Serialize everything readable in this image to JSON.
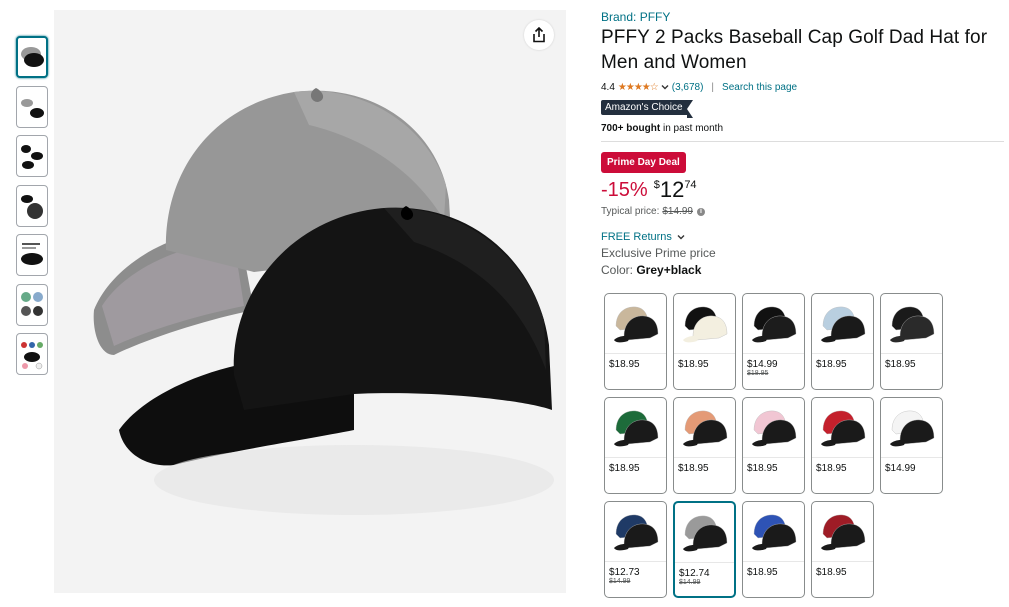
{
  "thumbnails": [
    {
      "name": "Grey+black main"
    },
    {
      "name": "Grey+black detail"
    },
    {
      "name": "Black cap views"
    },
    {
      "name": "Cap closeup"
    },
    {
      "name": "Product info"
    },
    {
      "name": "Lifestyle photos"
    },
    {
      "name": "Color options"
    }
  ],
  "product": {
    "brand": "Brand: PFFY",
    "title": "PFFY 2 Packs Baseball Cap Golf Dad Hat for Men and Women",
    "rating": "4.4",
    "stars": "★★★★☆",
    "review_count": "(3,678)",
    "search_link": "Search this page",
    "badge": "Amazon's Choice",
    "bought_bold": "700+ bought",
    "bought_rest": " in past month",
    "deal": "Prime Day Deal",
    "discount": "-15%",
    "currency": "$",
    "price_whole": "12",
    "price_fraction": "74",
    "typical_label": "Typical price:",
    "typical_price": "$14.99",
    "returns": "FREE Returns",
    "exclusive": "Exclusive Prime price",
    "color_label": "Color: ",
    "color_value": "Grey+black"
  },
  "swatches": [
    {
      "price": "$18.95",
      "old": "",
      "c1": "#c9b79c",
      "c2": "#1a1a1a"
    },
    {
      "price": "$18.95",
      "old": "",
      "c1": "#111111",
      "c2": "#f3efe0"
    },
    {
      "price": "$14.99",
      "old": "$18.95",
      "c1": "#111111",
      "c2": "#1c1c1c"
    },
    {
      "price": "$18.95",
      "old": "",
      "c1": "#b9cfe0",
      "c2": "#1a1a1a"
    },
    {
      "price": "$18.95",
      "old": "",
      "c1": "#1a1a1a",
      "c2": "#2a2a2a"
    },
    {
      "price": "$18.95",
      "old": "",
      "c1": "#1d6b3a",
      "c2": "#1a1a1a"
    },
    {
      "price": "$18.95",
      "old": "",
      "c1": "#e49a76",
      "c2": "#1a1a1a"
    },
    {
      "price": "$18.95",
      "old": "",
      "c1": "#f1c6d3",
      "c2": "#1a1a1a"
    },
    {
      "price": "$18.95",
      "old": "",
      "c1": "#c4202c",
      "c2": "#1a1a1a"
    },
    {
      "price": "$14.99",
      "old": "",
      "c1": "#f4f4f4",
      "c2": "#1a1a1a"
    },
    {
      "price": "$12.73",
      "old": "$14.99",
      "c1": "#1f3a66",
      "c2": "#1a1a1a"
    },
    {
      "price": "$12.74",
      "old": "$14.99",
      "c1": "#9a9a9a",
      "c2": "#1a1a1a",
      "selected": true
    },
    {
      "price": "$18.95",
      "old": "",
      "c1": "#2e53b5",
      "c2": "#1a1a1a"
    },
    {
      "price": "$18.95",
      "old": "",
      "c1": "#9e1c26",
      "c2": "#1a1a1a"
    }
  ],
  "colors": {
    "link": "#007185",
    "deal": "#cc0c39",
    "star": "#de7921",
    "badge": "#232f3e"
  }
}
